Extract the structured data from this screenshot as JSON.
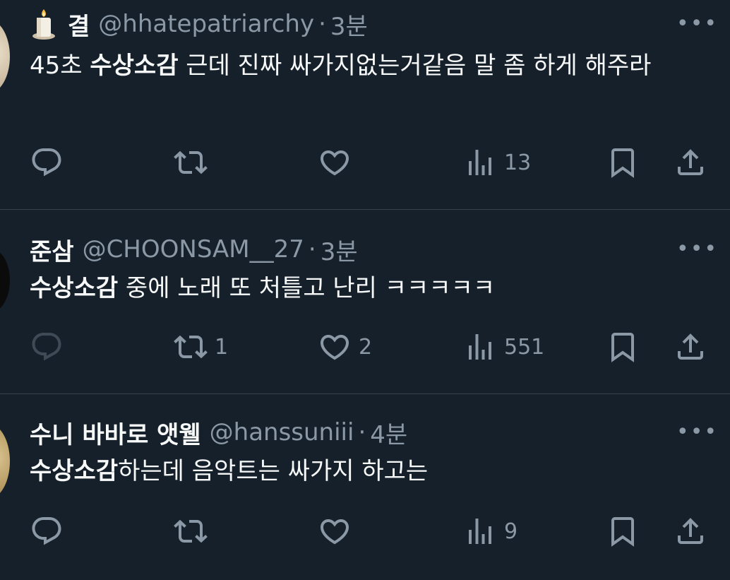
{
  "tweets": [
    {
      "name": "결",
      "handle": "@hhatepatriarchy",
      "separator": "·",
      "time": "3분",
      "text_prefix": "45초 ",
      "text_highlight": "수상소감",
      "text_suffix": " 근데 진짜 싸가지없는거같음 말 좀 하게 해주라",
      "reply_count": "",
      "retweet_count": "",
      "like_count": "",
      "view_count": "13"
    },
    {
      "name": "준삼",
      "handle": "@CHOONSAM__27",
      "separator": "·",
      "time": "3분",
      "text_prefix": "",
      "text_highlight": "수상소감",
      "text_suffix": " 중에 노래 또 처틀고 난리 ㅋㅋㅋㅋㅋ",
      "reply_count": "",
      "retweet_count": "1",
      "like_count": "2",
      "view_count": "551"
    },
    {
      "name": "수니 바바로 앳웰",
      "handle": "@hanssuniii",
      "separator": "·",
      "time": "4분",
      "text_prefix": "",
      "text_highlight": "수상소감",
      "text_suffix": "하는데 음악트는 싸가지 하고는",
      "reply_count": "",
      "retweet_count": "",
      "like_count": "",
      "view_count": "9"
    }
  ],
  "more_label": "•••",
  "icons": {
    "reply": "reply-icon",
    "retweet": "retweet-icon",
    "like": "heart-icon",
    "views": "views-icon",
    "bookmark": "bookmark-icon",
    "share": "share-icon",
    "candle": "candle-emoji"
  },
  "colors": {
    "background": "#15202b",
    "text": "#f7f9f9",
    "secondary": "#8b98a5",
    "divider": "#38444d"
  }
}
